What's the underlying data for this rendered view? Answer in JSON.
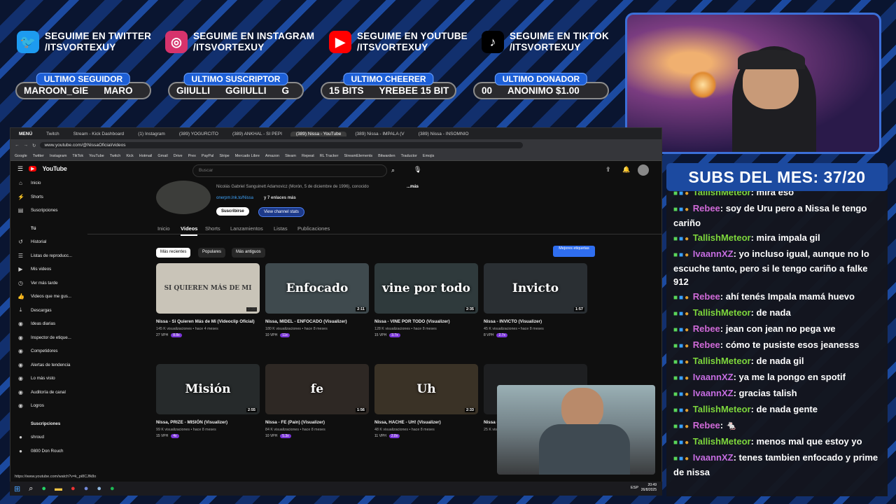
{
  "social": [
    {
      "icon": "twitter-icon",
      "line1": "SEGUIME EN TWITTER",
      "line2": "/ITSVORTEXUY",
      "color": "#1d9bf0",
      "glyph": "🐦"
    },
    {
      "icon": "instagram-icon",
      "line1": "SEGUIME EN INSTAGRAM",
      "line2": "/ITSVORTEXUY",
      "color": "#d6336c",
      "glyph": "◎"
    },
    {
      "icon": "youtube-icon",
      "line1": "SEGUIME EN YOUTUBE",
      "line2": "/ITSVORTEXUY",
      "color": "#ff0000",
      "glyph": "▶"
    },
    {
      "icon": "tiktok-icon",
      "line1": "SEGUIME EN TIKTOK",
      "line2": "/ITSVORTEXUY",
      "color": "#000000",
      "glyph": "♪"
    }
  ],
  "pills": [
    {
      "label": "ULTIMO SEGUIDOR",
      "a": "MAROON_GIE",
      "b": "MARO"
    },
    {
      "label": "ULTIMO SUSCRIPTOR",
      "a": "GIIULLI",
      "b": "GGIIULLI",
      "c": "G"
    },
    {
      "label": "ULTIMO CHEERER",
      "a": "15 BITS",
      "b": "YREBEE 15 BIT"
    },
    {
      "label": "ULTIMO DONADOR",
      "a": "00",
      "b": "ANONIMO $1.00"
    }
  ],
  "subs": "SUBS DEL MES: 37/20",
  "chat": [
    {
      "user": "TallishMeteor",
      "color": "#7dd63c",
      "text": ": mira eso"
    },
    {
      "user": "Rebee",
      "color": "#d06ad8",
      "text": ": soy de Uru pero a Nissa le tengo cariño"
    },
    {
      "user": "TallishMeteor",
      "color": "#7dd63c",
      "text": ": mira impala gil"
    },
    {
      "user": "IvaannXZ",
      "color": "#c56ce0",
      "text": ": yo incluso igual, aunque no lo escuche tanto, pero si le tengo cariño a falke 912"
    },
    {
      "user": "Rebee",
      "color": "#d06ad8",
      "text": ": ahí tenés Impala mamá huevo"
    },
    {
      "user": "TallishMeteor",
      "color": "#7dd63c",
      "text": ": de nada"
    },
    {
      "user": "Rebee",
      "color": "#d06ad8",
      "text": ": jean con jean no pega we"
    },
    {
      "user": "Rebee",
      "color": "#d06ad8",
      "text": ": cómo te pusiste esos jeanesss"
    },
    {
      "user": "TallishMeteor",
      "color": "#7dd63c",
      "text": ": de nada gil"
    },
    {
      "user": "IvaannXZ",
      "color": "#c56ce0",
      "text": ": ya me la pongo en spotif"
    },
    {
      "user": "IvaannXZ",
      "color": "#c56ce0",
      "text": ": gracias talish"
    },
    {
      "user": "TallishMeteor",
      "color": "#7dd63c",
      "text": ": de nada gente"
    },
    {
      "user": "Rebee",
      "color": "#d06ad8",
      "text": ": 🐁"
    },
    {
      "user": "TallishMeteor",
      "color": "#7dd63c",
      "text": ": menos mal que estoy yo"
    },
    {
      "user": "IvaannXZ",
      "color": "#c56ce0",
      "text": ": tenes tambien enfocado y prime de nissa"
    }
  ],
  "browser": {
    "menu": "MENÚ",
    "tabs": [
      "Twitch",
      "Stream - Kick Dashboard",
      "(1) Instagram",
      "(389) YOGURCITO",
      "(389) ANKHAL - SI PEPI",
      "(389) Nissa - YouTube",
      "(389) Nissa - IMPALA (V",
      "(389) Nissa - INSOMNIO"
    ],
    "url": "www.youtube.com/@NissaOficial/videos",
    "bookmarks": [
      "Google",
      "Twitter",
      "Instagram",
      "TikTok",
      "YouTube",
      "Twitch",
      "Kick",
      "Hotmail",
      "Gmail",
      "Drive",
      "Prex",
      "PayPal",
      "Stripe",
      "Mercado Libre",
      "Amazon",
      "Steam",
      "Repeat",
      "RL Tracker",
      "StreamElements",
      "Bitwarden",
      "Traductor",
      "Emojis"
    ]
  },
  "yt": {
    "search_placeholder": "Buscar",
    "channel_desc": "Nicolás Gabriel Sanguinett Adamovicz (Morón, 5 de diciembre de 1996), conocido",
    "more": "...más",
    "links": "onerpm.lnk.to/Nissa",
    "links_more": "y 7 enlaces más",
    "subscribe": "Suscribirse",
    "stats": "View channel stats",
    "tabs": [
      "Inicio",
      "Videos",
      "Shorts",
      "Lanzamientos",
      "Listas",
      "Publicaciones"
    ],
    "chips": [
      "Más recientes",
      "Populares",
      "Más antiguos"
    ],
    "best_tags": "Mejores etiquetas",
    "sidebar": [
      {
        "icon": "home-icon",
        "label": "Inicio",
        "glyph": "⌂"
      },
      {
        "icon": "shorts-icon",
        "label": "Shorts",
        "glyph": "⚡"
      },
      {
        "icon": "subscriptions-icon",
        "label": "Suscripciones",
        "glyph": "▤"
      },
      {
        "icon": "user-icon",
        "label": "Tú",
        "glyph": ""
      },
      {
        "icon": "history-icon",
        "label": "Historial",
        "glyph": "↺"
      },
      {
        "icon": "playlist-icon",
        "label": "Listas de reproducc...",
        "glyph": "☰"
      },
      {
        "icon": "videos-icon",
        "label": "Mis videos",
        "glyph": "▶"
      },
      {
        "icon": "later-icon",
        "label": "Ver más tarde",
        "glyph": "◷"
      },
      {
        "icon": "like-icon",
        "label": "Videos que me gus...",
        "glyph": "👍"
      },
      {
        "icon": "download-icon",
        "label": "Descargas",
        "glyph": "⤓"
      },
      {
        "icon": "ideas-icon",
        "label": "Ideas diarias",
        "glyph": "◉"
      },
      {
        "icon": "tags-icon",
        "label": "Inspector de etique...",
        "glyph": "◉"
      },
      {
        "icon": "competitors-icon",
        "label": "Competidores",
        "glyph": "◉"
      },
      {
        "icon": "trends-icon",
        "label": "Alertas de tendencia",
        "glyph": "◉"
      },
      {
        "icon": "most-seen-icon",
        "label": "Lo más visto",
        "glyph": "◉"
      },
      {
        "icon": "audit-icon",
        "label": "Auditoría de canal",
        "glyph": "◉"
      },
      {
        "icon": "awards-icon",
        "label": "Logros",
        "glyph": "◉"
      },
      {
        "icon": "subs-heading",
        "label": "Suscripciones",
        "glyph": ""
      },
      {
        "icon": "channel-avatar",
        "label": "shroud",
        "glyph": "●"
      },
      {
        "icon": "channel-avatar",
        "label": "0800 Don Rouch",
        "glyph": "●"
      }
    ],
    "videos": [
      {
        "thumb": "SI QUIEREN MÁS DE MI",
        "dur": "2:39",
        "title": "Nissa - Si Quieren Más de Mi (Videoclip Oficial)",
        "meta": "145 K visualizaciones • hace 4 meses",
        "vph": "27 VPH",
        "x": "8.8x",
        "bg": "#c9c4b8"
      },
      {
        "thumb": "Enfocado",
        "dur": "2:11",
        "title": "Nissa, MIDEL - ENFOCADO (Visualizer)",
        "meta": "180 K visualizaciones • hace 8 meses",
        "vph": "10 VPH",
        "x": "11x",
        "bg": "#3f4a4e"
      },
      {
        "thumb": "vine por todo",
        "dur": "2:35",
        "title": "Nissa - VINE POR TODO (Visualizer)",
        "meta": "128 K visualizaciones • hace 8 meses",
        "vph": "15 VPH",
        "x": "3.7x",
        "bg": "#2f3a3c"
      },
      {
        "thumb": "Invicto",
        "dur": "1:57",
        "title": "Nissa - INVICTO (Visualizer)",
        "meta": "45 K visualizaciones • hace 8 meses",
        "vph": "8 VPH",
        "x": "2.7x",
        "bg": "#2a2f33"
      },
      {
        "thumb": "Misión",
        "dur": "2:55",
        "title": "Nissa, PRIZE - MISIÓN (Visualizer)",
        "meta": "99 K visualizaciones • hace 8 meses",
        "vph": "15 VPH",
        "x": "4x",
        "bg": "#262a2b"
      },
      {
        "thumb": "fe",
        "dur": "1:56",
        "title": "Nissa - FE (Pain) (Visualizer)",
        "meta": "84 K visualizaciones • hace 8 meses",
        "vph": "10 VPH",
        "x": "5.3x",
        "bg": "#2e2824"
      },
      {
        "thumb": "Uh",
        "dur": "2:33",
        "title": "Nissa, HACHE - UH! (Visualizer)",
        "meta": "48 K visualizaciones • hace 8 meses",
        "vph": "11 VPH",
        "x": "2.8x",
        "bg": "#3a3226"
      },
      {
        "thumb": "",
        "dur": "",
        "title": "Nissa -",
        "meta": "25 K visu",
        "vph": "",
        "x": "",
        "bg": "#1e1f21"
      }
    ]
  },
  "taskbar": {
    "lang": "ESP",
    "time": "20:49",
    "date": "26/8/2025",
    "status_url": "https://www.youtube.com/watch?v=k_pi8CJfk8o"
  }
}
